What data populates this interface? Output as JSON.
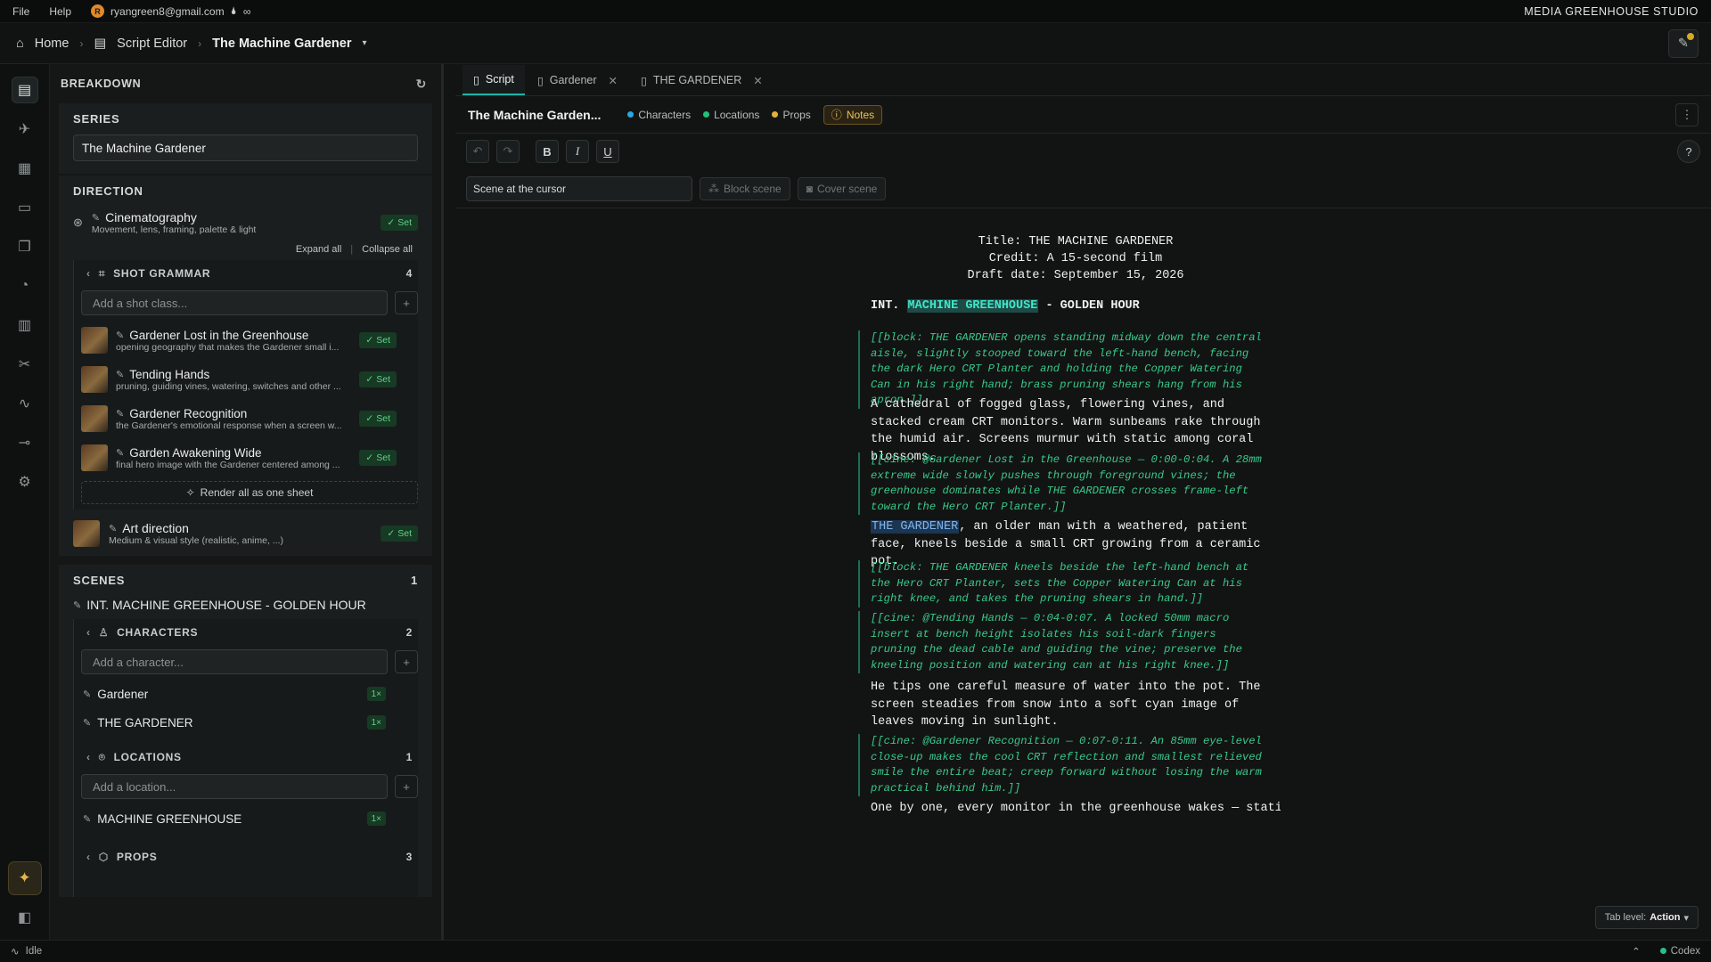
{
  "menubar": {
    "file": "File",
    "help": "Help",
    "avatar_initial": "R",
    "email": "ryangreen8@gmail.com",
    "credits": "∞",
    "studio": "MEDIA GREENHOUSE STUDIO"
  },
  "breadcrumb": {
    "home": "Home",
    "editor": "Script Editor",
    "current": "The Machine Gardener"
  },
  "panel": {
    "title": "BREAKDOWN",
    "series_label": "SERIES",
    "series_value": "The Machine Gardener",
    "direction_label": "DIRECTION",
    "cinematography": {
      "title": "Cinematography",
      "desc": "Movement, lens, framing, palette & light",
      "badge": "Set"
    },
    "expand_all": "Expand all",
    "collapse_all": "Collapse all",
    "shot_grammar": {
      "label": "SHOT GRAMMAR",
      "count": "4",
      "placeholder": "Add a shot class...",
      "items": [
        {
          "title": "Gardener Lost in the Greenhouse",
          "desc": "opening geography that makes the Gardener small i...",
          "badge": "Set"
        },
        {
          "title": "Tending Hands",
          "desc": "pruning, guiding vines, watering, switches and other ...",
          "badge": "Set"
        },
        {
          "title": "Gardener Recognition",
          "desc": "the Gardener's emotional response when a screen w...",
          "badge": "Set"
        },
        {
          "title": "Garden Awakening Wide",
          "desc": "final hero image with the Gardener centered among ...",
          "badge": "Set"
        }
      ],
      "render_all": "Render all as one sheet"
    },
    "art_direction": {
      "title": "Art direction",
      "desc": "Medium & visual style (realistic, anime, ...)",
      "badge": "Set"
    },
    "scenes_label": "SCENES",
    "scenes_count": "1",
    "scene_heading": "INT. MACHINE GREENHOUSE - GOLDEN HOUR",
    "characters": {
      "label": "CHARACTERS",
      "count": "2",
      "placeholder": "Add a character...",
      "items": [
        {
          "name": "Gardener",
          "count": "1×"
        },
        {
          "name": "THE GARDENER",
          "count": "1×"
        }
      ]
    },
    "locations": {
      "label": "LOCATIONS",
      "count": "1",
      "placeholder": "Add a location...",
      "items": [
        {
          "name": "MACHINE GREENHOUSE",
          "count": "1×"
        }
      ]
    },
    "props": {
      "label": "PROPS",
      "count": "3"
    }
  },
  "tabs": [
    {
      "label": "Script"
    },
    {
      "label": "Gardener"
    },
    {
      "label": "THE GARDENER"
    }
  ],
  "docbar": {
    "title": "The Machine Garden...",
    "characters": "Characters",
    "locations": "Locations",
    "props": "Props",
    "notes": "Notes"
  },
  "colors": {
    "characters": "#2aa8e0",
    "locations": "#22c07a",
    "props": "#e0b23a",
    "accent": "#1fb5a8"
  },
  "scenebar": {
    "select": "Scene at the cursor",
    "block": "Block scene",
    "cover": "Cover scene"
  },
  "script": {
    "title": "Title: THE MACHINE GARDENER",
    "credit": "Credit: A 15-second film",
    "draft": "Draft date: September 15, 2026",
    "heading_pre": "INT. ",
    "heading_loc": "MACHINE GREENHOUSE",
    "heading_post": " - GOLDEN HOUR",
    "note1": "[[block: THE GARDENER opens standing midway down the central aisle, slightly stooped toward the left-hand bench, facing the dark Hero CRT Planter and holding the Copper Watering Can in his right hand; brass pruning shears hang from his apron.]]",
    "action1": "A cathedral of fogged glass, flowering vines, and stacked cream CRT monitors. Warm sunbeams rake through the humid air. Screens murmur with static among coral blossoms.",
    "note2": "[[cine: @Gardener Lost in the Greenhouse — 0:00-0:04. A 28mm extreme wide slowly pushes through foreground vines; the greenhouse dominates while THE GARDENER crosses frame-left toward the Hero CRT Planter.]]",
    "char_name": "THE GARDENER",
    "action2": ", an older man with a weathered, patient face, kneels beside a small CRT growing from a ceramic pot.",
    "note3": "[[block: THE GARDENER kneels beside the left-hand bench at the Hero CRT Planter, sets the Copper Watering Can at his right knee, and takes the pruning shears in hand.]]",
    "note4": "[[cine: @Tending Hands — 0:04-0:07. A locked 50mm macro insert at bench height isolates his soil-dark fingers pruning the dead cable and guiding the vine; preserve the kneeling position and watering can at his right knee.]]",
    "action3": "He tips one careful measure of water into the pot. The screen steadies from snow into a soft cyan image of leaves moving in sunlight.",
    "note5": "[[cine: @Gardener Recognition — 0:07-0:11. An 85mm eye-level close-up makes the cool CRT reflection and smallest relieved smile the entire beat; creep forward without losing the warm practical behind him.]]",
    "action4": "One by one, every monitor in the greenhouse wakes — static"
  },
  "tab_level": {
    "label": "Tab level:",
    "value": "Action"
  },
  "status": {
    "state": "Idle",
    "codex": "Codex"
  }
}
